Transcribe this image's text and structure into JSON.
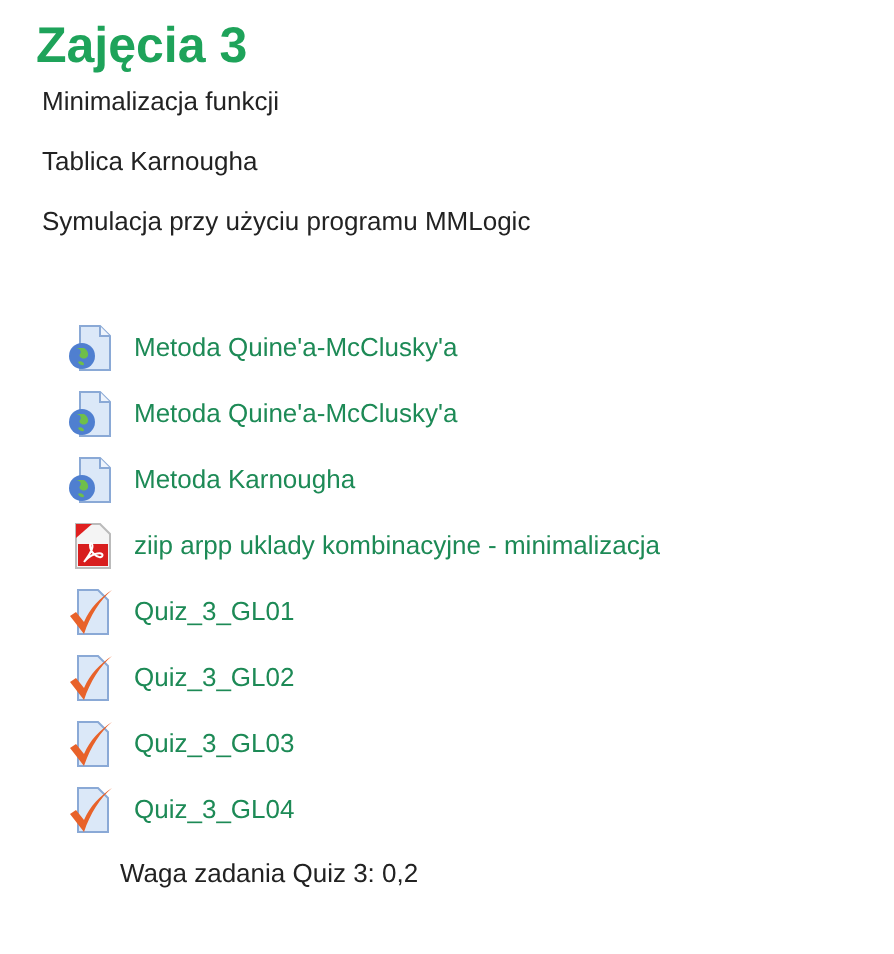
{
  "title": "Zajęcia 3",
  "paragraphs": [
    "Minimalizacja funkcji",
    "Tablica Karnougha",
    "Symulacja przy użyciu programu MMLogic"
  ],
  "activities": [
    {
      "kind": "url",
      "label": "Metoda Quine'a-McClusky'a"
    },
    {
      "kind": "url",
      "label": "Metoda Quine'a-McClusky'a"
    },
    {
      "kind": "url",
      "label": "Metoda Karnougha"
    },
    {
      "kind": "pdf",
      "label": "ziip arpp uklady kombinacyjne - minimalizacja"
    },
    {
      "kind": "quiz",
      "label": "Quiz_3_GL01"
    },
    {
      "kind": "quiz",
      "label": "Quiz_3_GL02"
    },
    {
      "kind": "quiz",
      "label": "Quiz_3_GL03"
    },
    {
      "kind": "quiz",
      "label": "Quiz_3_GL04"
    }
  ],
  "note": "Waga zadania Quiz 3: 0,2"
}
